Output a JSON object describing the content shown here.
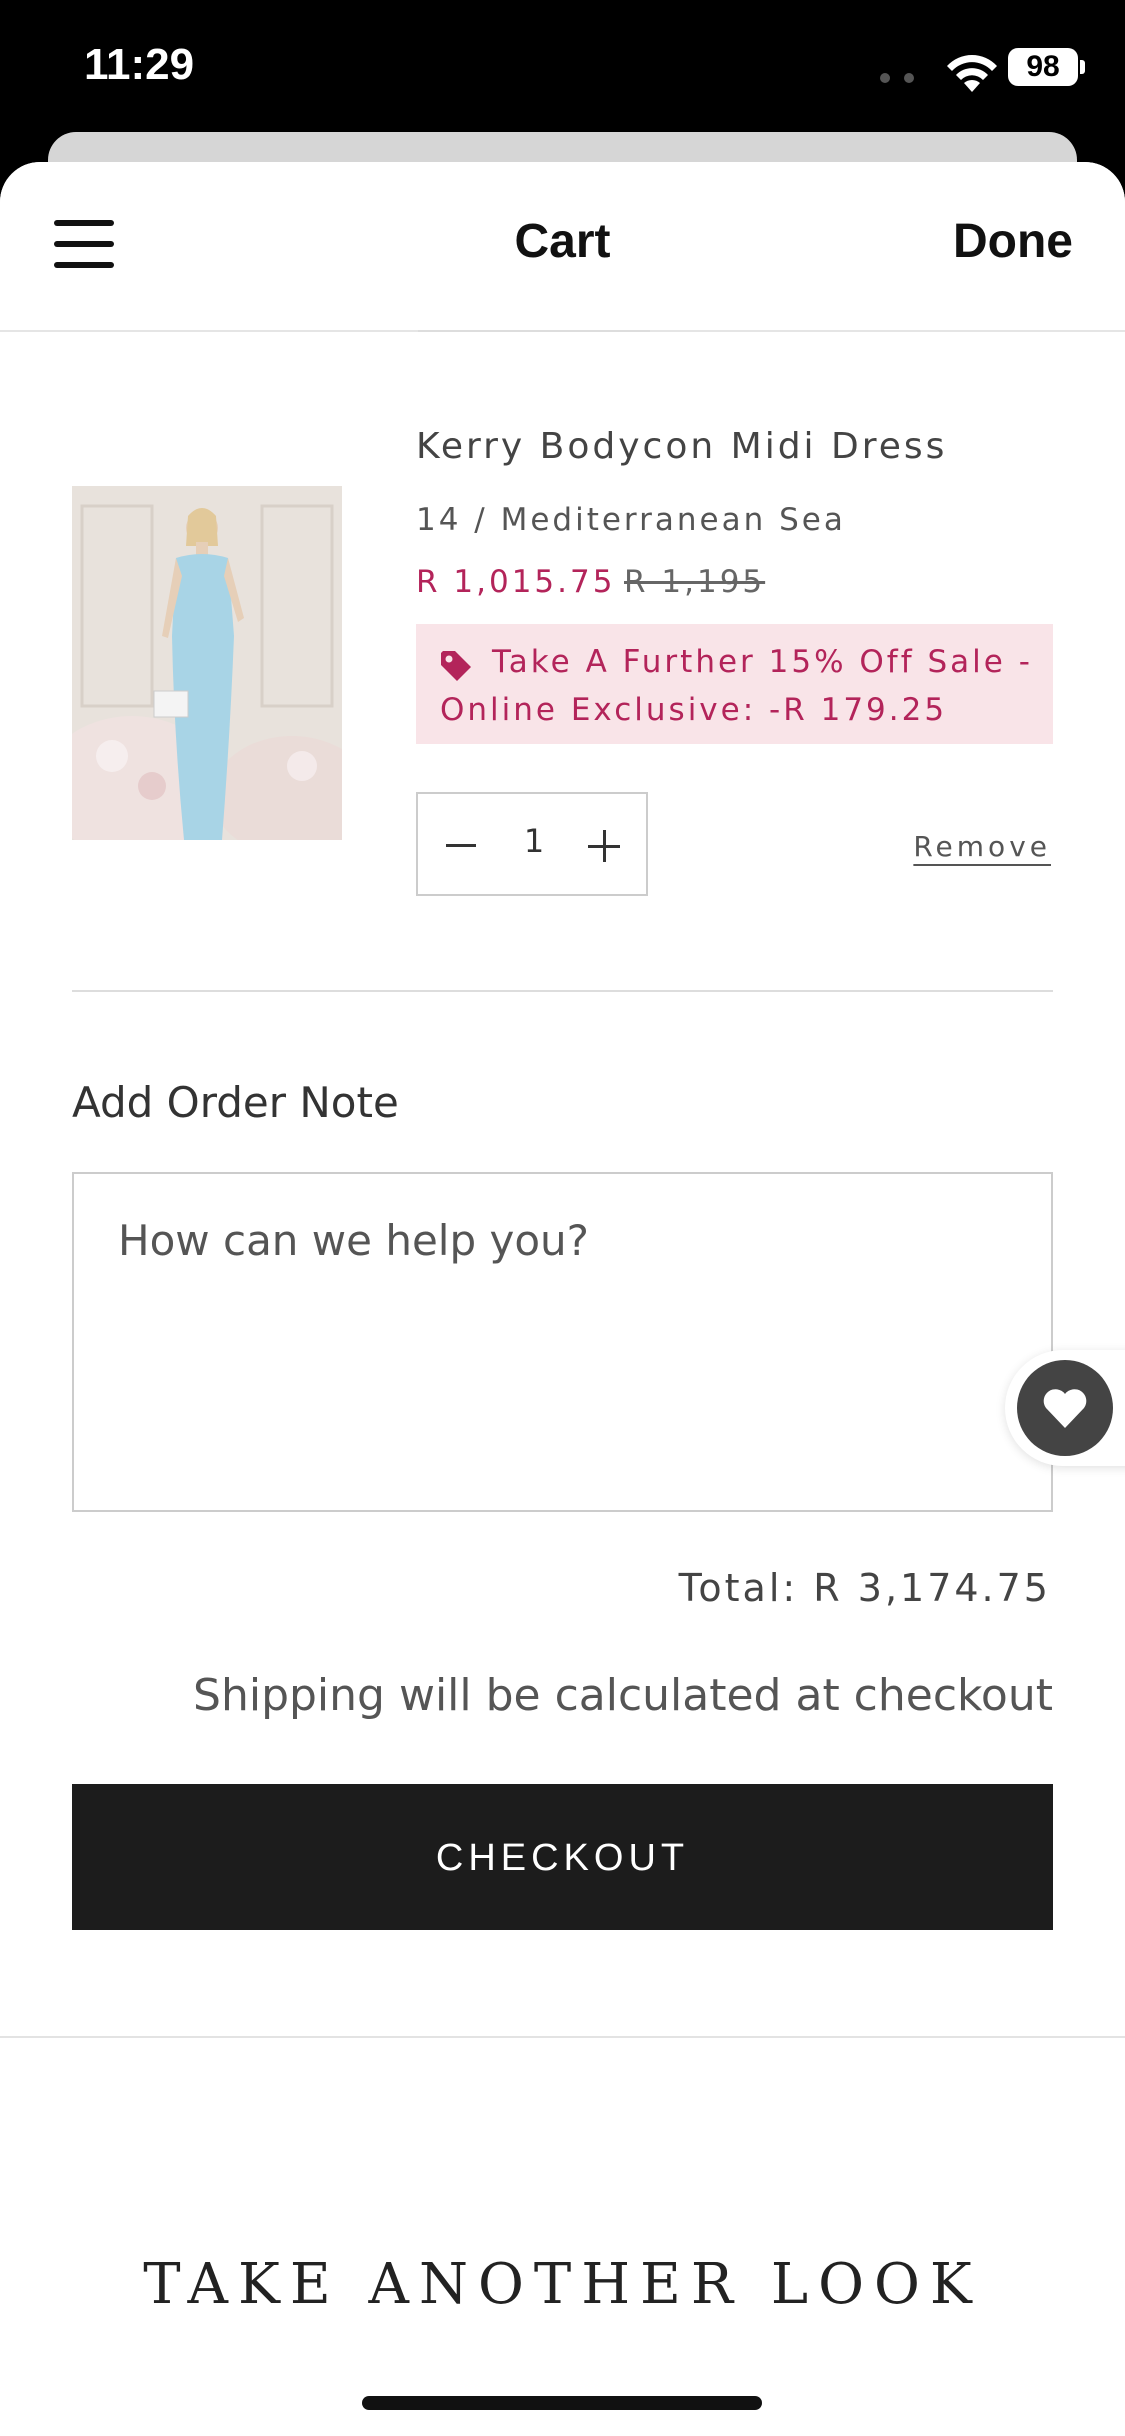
{
  "status_bar": {
    "time": "11:29",
    "battery": "98"
  },
  "nav": {
    "title": "Cart",
    "done_label": "Done"
  },
  "cart_item": {
    "name": "Kerry Bodycon Midi Dress",
    "variant": "14 / Mediterranean Sea",
    "sale_price": "R 1,015.75",
    "original_price": "R 1,195",
    "discount_text": "Take A Further 15% Off Sale - Online Exclusive: -R 179.25",
    "quantity": "1",
    "remove_label": "Remove",
    "image_colors": {
      "dress": "#a8d4e6",
      "background": "#e8e2dc",
      "flowers": "#f0e4e4"
    }
  },
  "order_note": {
    "label": "Add Order Note",
    "placeholder": "How can we help you?"
  },
  "summary": {
    "total": "Total: R 3,174.75",
    "shipping_note": "Shipping will be calculated at checkout",
    "checkout_label": "CHECKOUT"
  },
  "recommendations": {
    "heading": "TAKE ANOTHER LOOK"
  },
  "colors": {
    "accent": "#b3245a",
    "discount_bg": "#f9e4e8",
    "button": "#1c1c1c"
  },
  "icons": [
    "menu-icon",
    "tag-icon",
    "minus-icon",
    "plus-icon",
    "heart-icon",
    "wifi-icon",
    "battery-icon"
  ]
}
